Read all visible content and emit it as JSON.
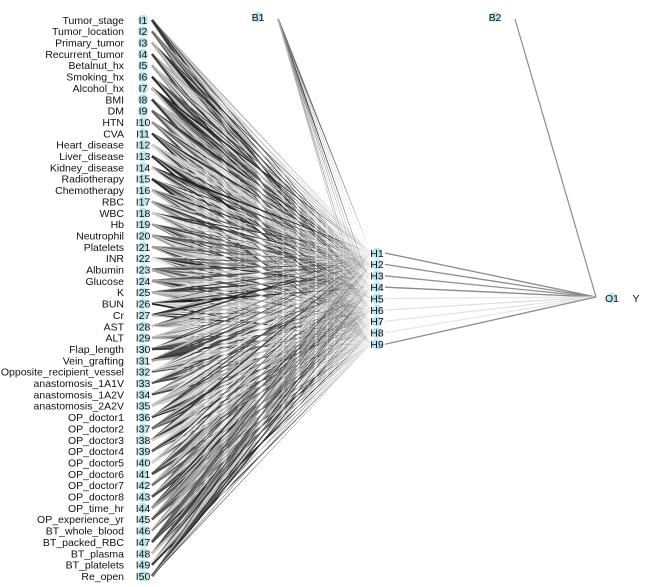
{
  "diagram": {
    "type": "neural-network",
    "input_nodes": [
      {
        "id": "I1",
        "variable": "Tumor_stage"
      },
      {
        "id": "I2",
        "variable": "Tumor_location"
      },
      {
        "id": "I3",
        "variable": "Primary_tumor"
      },
      {
        "id": "I4",
        "variable": "Recurrent_tumor"
      },
      {
        "id": "I5",
        "variable": "Betalnut_hx"
      },
      {
        "id": "I6",
        "variable": "Smoking_hx"
      },
      {
        "id": "I7",
        "variable": "Alcohol_hx"
      },
      {
        "id": "I8",
        "variable": "BMI"
      },
      {
        "id": "I9",
        "variable": "DM"
      },
      {
        "id": "I10",
        "variable": "HTN"
      },
      {
        "id": "I11",
        "variable": "CVA"
      },
      {
        "id": "I12",
        "variable": "Heart_disease"
      },
      {
        "id": "I13",
        "variable": "Liver_disease"
      },
      {
        "id": "I14",
        "variable": "Kidney_disease"
      },
      {
        "id": "I15",
        "variable": "Radiotherapy"
      },
      {
        "id": "I16",
        "variable": "Chemotherapy"
      },
      {
        "id": "I17",
        "variable": "RBC"
      },
      {
        "id": "I18",
        "variable": "WBC"
      },
      {
        "id": "I19",
        "variable": "Hb"
      },
      {
        "id": "I20",
        "variable": "Neutrophil"
      },
      {
        "id": "I21",
        "variable": "Platelets"
      },
      {
        "id": "I22",
        "variable": "INR"
      },
      {
        "id": "I23",
        "variable": "Albumin"
      },
      {
        "id": "I24",
        "variable": "Glucose"
      },
      {
        "id": "I25",
        "variable": "K"
      },
      {
        "id": "I26",
        "variable": "BUN"
      },
      {
        "id": "I27",
        "variable": "Cr"
      },
      {
        "id": "I28",
        "variable": "AST"
      },
      {
        "id": "I29",
        "variable": "ALT"
      },
      {
        "id": "I30",
        "variable": "Flap_length"
      },
      {
        "id": "I31",
        "variable": "Vein_grafting"
      },
      {
        "id": "I32",
        "variable": "Opposite_recipient_vessel"
      },
      {
        "id": "I33",
        "variable": "anastomosis_1A1V"
      },
      {
        "id": "I34",
        "variable": "anastomosis_1A2V"
      },
      {
        "id": "I35",
        "variable": "anastomosis_2A2V"
      },
      {
        "id": "I36",
        "variable": "OP_doctor1"
      },
      {
        "id": "I37",
        "variable": "OP_doctor2"
      },
      {
        "id": "I38",
        "variable": "OP_doctor3"
      },
      {
        "id": "I39",
        "variable": "OP_doctor4"
      },
      {
        "id": "I40",
        "variable": "OP_doctor5"
      },
      {
        "id": "I41",
        "variable": "OP_doctor6"
      },
      {
        "id": "I42",
        "variable": "OP_doctor7"
      },
      {
        "id": "I43",
        "variable": "OP_doctor8"
      },
      {
        "id": "I44",
        "variable": "OP_time_hr"
      },
      {
        "id": "I45",
        "variable": "OP_experience_yr"
      },
      {
        "id": "I46",
        "variable": "BT_whole_blood"
      },
      {
        "id": "I47",
        "variable": "BT_packed_RBC"
      },
      {
        "id": "I48",
        "variable": "BT_plasma"
      },
      {
        "id": "I49",
        "variable": "BT_platelets"
      },
      {
        "id": "I50",
        "variable": "Re_open"
      }
    ],
    "hidden_nodes": [
      "H1",
      "H2",
      "H3",
      "H4",
      "H5",
      "H6",
      "H7",
      "H8",
      "H9"
    ],
    "bias_nodes": [
      "B1",
      "B2"
    ],
    "output_nodes": [
      {
        "id": "O1",
        "variable": "Y"
      }
    ],
    "hidden_to_output_shade": [
      "#888888",
      "#8c8c8c",
      "#909090",
      "#8a8a8a",
      "#e6e6e6",
      "#e0e0e0",
      "#e4e4e4",
      "#e8e8e8",
      "#8e8e8e"
    ],
    "b2_to_output_shade": "#8a8a8a",
    "node_color": "#b9e3ef"
  }
}
